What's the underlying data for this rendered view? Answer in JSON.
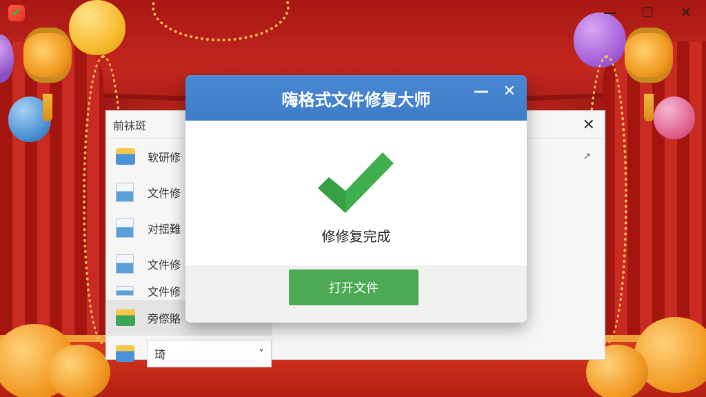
{
  "app": {
    "logo_icon": "app-check-logo",
    "window_controls": {
      "minimize": "—",
      "maximize": "☐",
      "close": "✕"
    }
  },
  "background_window": {
    "title": "前袜斑",
    "close": "✕",
    "pencil": "↗",
    "rows": [
      {
        "icon": "folder-icon",
        "label": "软研修"
      },
      {
        "icon": "document-icon",
        "label": "文件修"
      },
      {
        "icon": "document-icon",
        "label": "对揺難"
      },
      {
        "icon": "document-icon",
        "label": "文件修"
      },
      {
        "icon": "document-icon",
        "label": "文件修"
      },
      {
        "icon": "folder-icon",
        "label": "旁傺賂"
      }
    ],
    "dropdown": {
      "value": "琦",
      "chevron": "˅"
    }
  },
  "dialog": {
    "title": "嗨格式文件修复大师",
    "minimize": "—",
    "close": "✕",
    "status_icon": "checkmark-icon",
    "status_text": "修修复完成",
    "primary_button": "打开文件",
    "colors": {
      "header": "#3e7cc8",
      "check": "#3fae4c",
      "button": "#4caa54"
    }
  }
}
